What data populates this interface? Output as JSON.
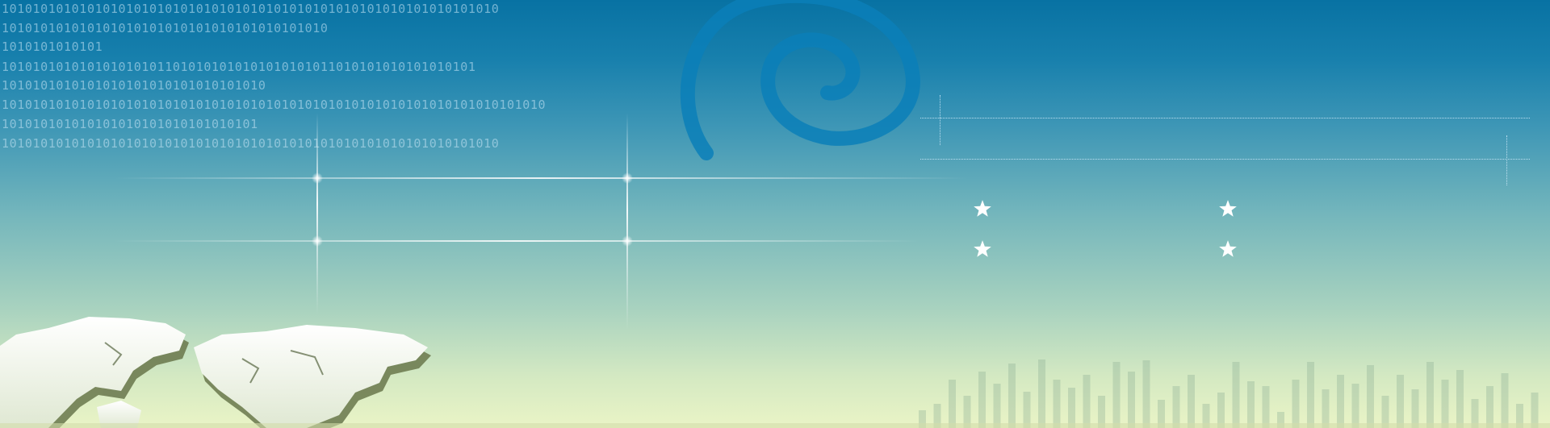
{
  "binary_lines": [
    "1010101010101010101010101010101010101010101010101010101010101010",
    "101010101010101010101010101010101010101010",
    "1010101010101",
    "1010101010101010101011010101010101010101011010101010101010101",
    "1010101010101010101010101010101010",
    "1010101010101010101010101010101010101010101010101010101010101010101010",
    "101010101010101010101010101010101",
    "1010101010101010101010101010101010101010101010101010101010101010"
  ],
  "colors": {
    "top": "#0872a3",
    "bottom": "#eaf4c6",
    "spiral": "#0a7fb8",
    "map_land": "#f4f7ef"
  }
}
